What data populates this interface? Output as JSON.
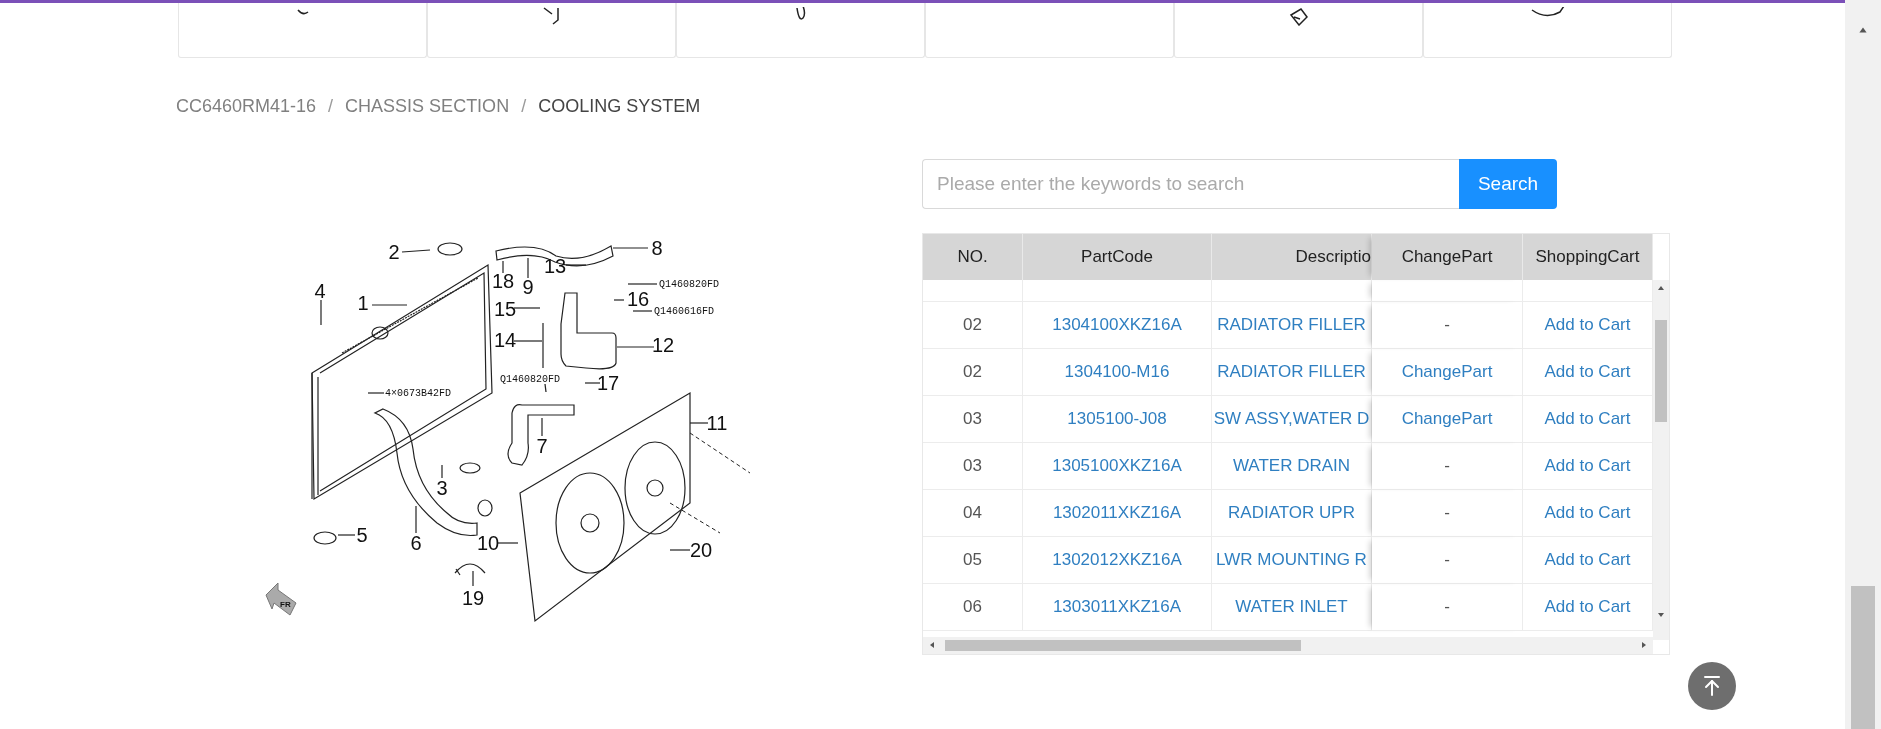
{
  "thumbnails": [
    {
      "kind": "drawing"
    },
    {
      "kind": "drawing"
    },
    {
      "kind": "drawing"
    },
    {
      "kind": "blank"
    },
    {
      "kind": "drawing"
    },
    {
      "kind": "drawing"
    }
  ],
  "breadcrumb": [
    {
      "kind": "link",
      "label": "CC6460RM41-16",
      "current": false
    },
    {
      "kind": "separator",
      "label": "/",
      "current": false
    },
    {
      "kind": "link",
      "label": "CHASSIS SECTION",
      "current": false
    },
    {
      "kind": "separator",
      "label": "/",
      "current": false
    },
    {
      "kind": "link",
      "label": "COOLING SYSTEM",
      "current": true
    }
  ],
  "diagram": {
    "callouts": [
      "2",
      "4",
      "1",
      "18",
      "9",
      "13",
      "8",
      "Q1460820FD",
      "16",
      "Q1460616FD",
      "15",
      "14",
      "12",
      "Q1460820FD",
      "17",
      "4×0673B42FD",
      "11",
      "7",
      "3",
      "5",
      "6",
      "10",
      "20",
      "19"
    ],
    "direction": "FR"
  },
  "search": {
    "placeholder": "Please enter the keywords to search",
    "button": "Search"
  },
  "table": {
    "columns": [
      "NO.",
      "PartCode",
      "Descriptio",
      "ChangePart",
      "ShoppingCart"
    ],
    "rows": [
      {
        "no": "02",
        "part_code": "1304100XKZ16A",
        "description": "RADIATOR FILLER",
        "change_part": {
          "kind": "none",
          "text": "-"
        },
        "cart": "Add to Cart"
      },
      {
        "no": "02",
        "part_code": "1304100-M16",
        "description": "RADIATOR FILLER",
        "change_part": {
          "kind": "link",
          "text": "ChangePart"
        },
        "cart": "Add to Cart"
      },
      {
        "no": "03",
        "part_code": "1305100-J08",
        "description": "SW ASSY,WATER D",
        "change_part": {
          "kind": "link",
          "text": "ChangePart"
        },
        "cart": "Add to Cart"
      },
      {
        "no": "03",
        "part_code": "1305100XKZ16A",
        "description": "WATER DRAIN",
        "change_part": {
          "kind": "none",
          "text": "-"
        },
        "cart": "Add to Cart"
      },
      {
        "no": "04",
        "part_code": "1302011XKZ16A",
        "description": "RADIATOR UPR",
        "change_part": {
          "kind": "none",
          "text": "-"
        },
        "cart": "Add to Cart"
      },
      {
        "no": "05",
        "part_code": "1302012XKZ16A",
        "description": "LWR MOUNTING R",
        "change_part": {
          "kind": "none",
          "text": "-"
        },
        "cart": "Add to Cart"
      },
      {
        "no": "06",
        "part_code": "1303011XKZ16A",
        "description": "WATER INLET",
        "change_part": {
          "kind": "none",
          "text": "-"
        },
        "cart": "Add to Cart"
      }
    ]
  }
}
